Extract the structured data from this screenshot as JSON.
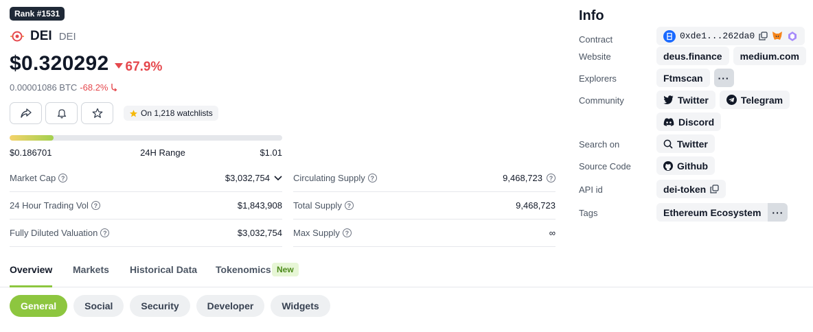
{
  "rank": "Rank #1531",
  "coin": {
    "name": "DEI",
    "symbol": "DEI"
  },
  "price": {
    "usd": "$0.320292",
    "change": "67.9%",
    "btc": "0.00001086 BTC",
    "btc_change": "-68.2%"
  },
  "watchlist": "On 1,218 watchlists",
  "range": {
    "low": "$0.186701",
    "label": "24H Range",
    "high": "$1.01",
    "position": 0.16
  },
  "stats": {
    "market_cap": {
      "label": "Market Cap",
      "value": "$3,032,754"
    },
    "volume": {
      "label": "24 Hour Trading Vol",
      "value": "$1,843,908"
    },
    "fdv": {
      "label": "Fully Diluted Valuation",
      "value": "$3,032,754"
    },
    "circulating": {
      "label": "Circulating Supply",
      "value": "9,468,723"
    },
    "total": {
      "label": "Total Supply",
      "value": "9,468,723"
    },
    "max": {
      "label": "Max Supply",
      "value": "∞"
    }
  },
  "tabs": [
    "Overview",
    "Markets",
    "Historical Data",
    "Tokenomics"
  ],
  "new_badge": "New",
  "pills": [
    "General",
    "Social",
    "Security",
    "Developer",
    "Widgets"
  ],
  "info": {
    "title": "Info",
    "contract_label": "Contract",
    "contract": "0xde1...262da0",
    "website_label": "Website",
    "websites": [
      "deus.finance",
      "medium.com"
    ],
    "explorers_label": "Explorers",
    "explorer": "Ftmscan",
    "community_label": "Community",
    "community": [
      "Twitter",
      "Telegram",
      "Discord"
    ],
    "search_label": "Search on",
    "search": "Twitter",
    "source_label": "Source Code",
    "source": "Github",
    "api_label": "API id",
    "api": "dei-token",
    "tags_label": "Tags",
    "tag": "Ethereum Ecosystem",
    "more": "···"
  },
  "colors": {
    "accent": "#8dc63f",
    "negative": "#e5484d",
    "dark": "#1f2937"
  }
}
